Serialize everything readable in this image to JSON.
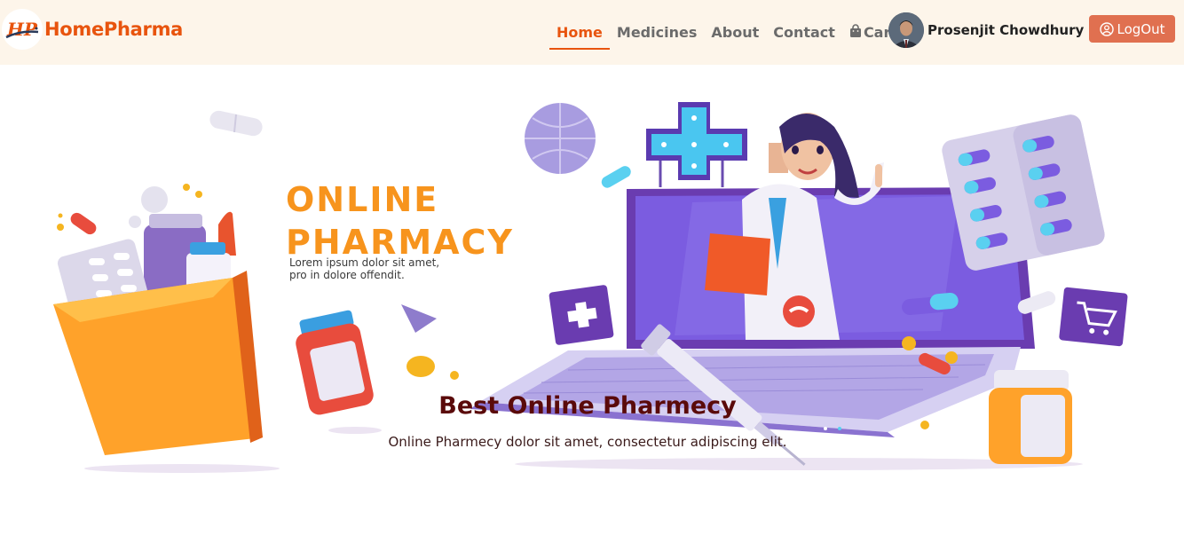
{
  "brand": {
    "name": "HomePharma",
    "logo_text": "HP"
  },
  "nav": {
    "items": [
      {
        "label": "Home",
        "active": true
      },
      {
        "label": "Medicines",
        "active": false
      },
      {
        "label": "About",
        "active": false
      },
      {
        "label": "Contact",
        "active": false
      }
    ],
    "cart_label": "Cart"
  },
  "user": {
    "name": "Prosenjit Chowdhury",
    "logout_label": "LogOut"
  },
  "hero": {
    "banner_line1": "ONLINE",
    "banner_line2": "PHARMACY",
    "banner_text_line1": "Lorem ipsum dolor sit amet,",
    "banner_text_line2": "pro in dolore offendit.",
    "title": "Best Online Pharmecy",
    "subtitle": "Online Pharmecy dolor sit amet, consectetur adipiscing elit."
  },
  "colors": {
    "brand": "#e8540e",
    "navbar_bg": "#fdf5ea",
    "logout_bg": "#e07050",
    "banner_orange": "#f7941d",
    "hero_title": "#5a0a0a"
  }
}
